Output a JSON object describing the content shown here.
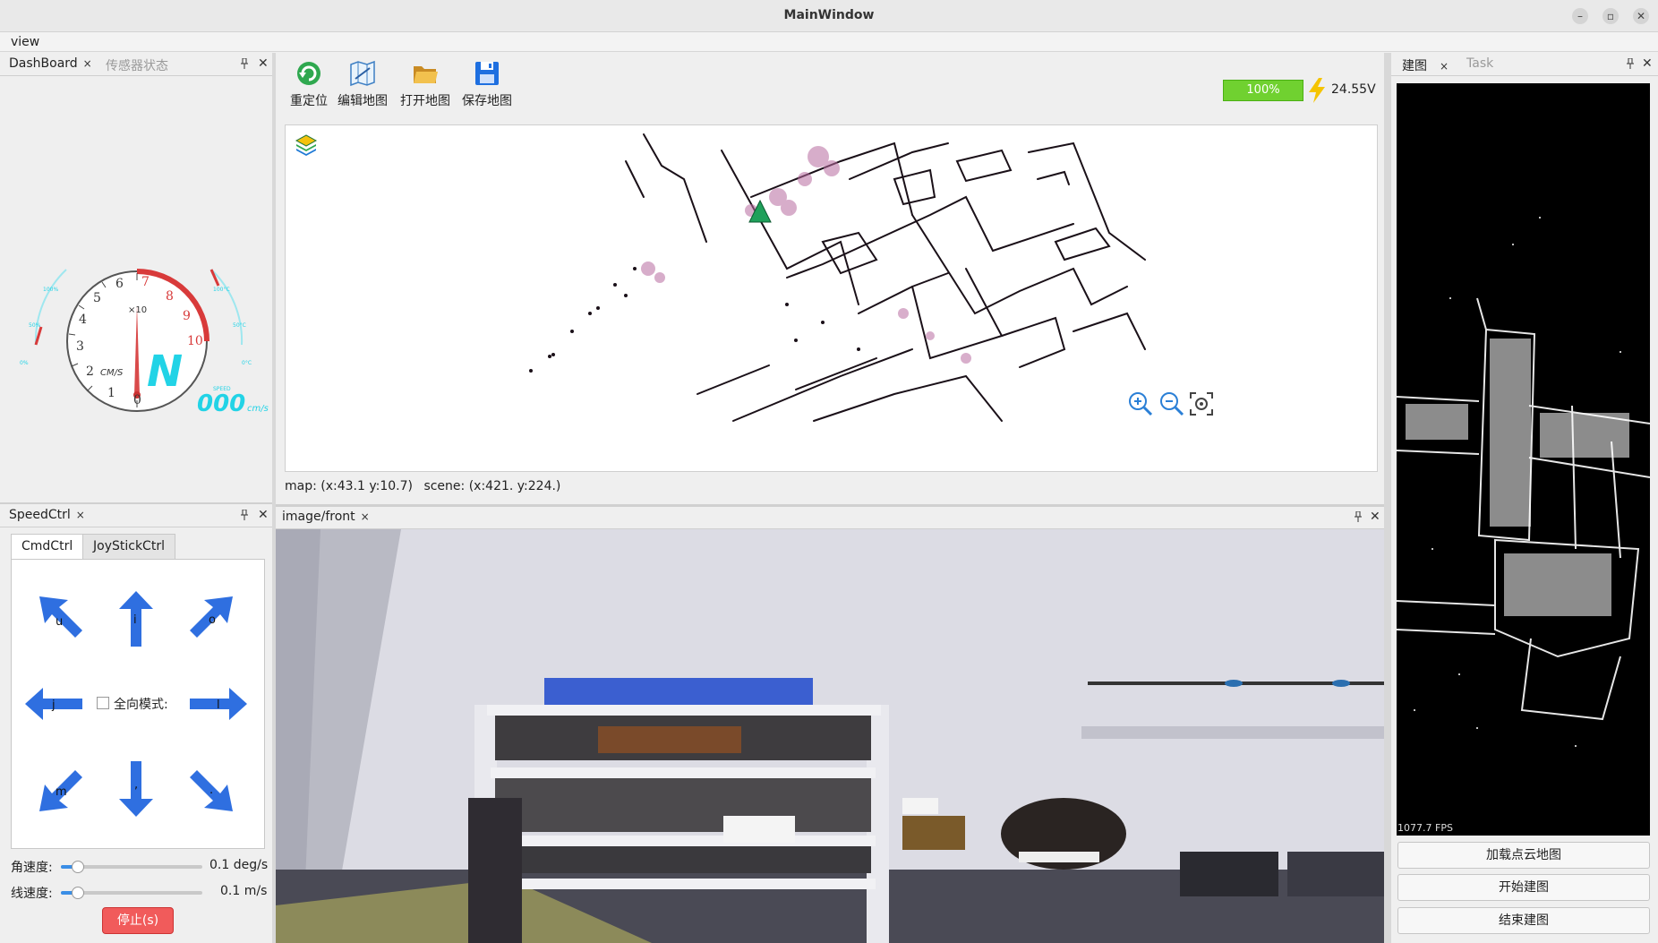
{
  "window": {
    "title": "MainWindow",
    "minimize": "–",
    "maximize": "▫",
    "close": "✕"
  },
  "menubar": {
    "view": "view"
  },
  "dashboard_dock": {
    "tabs": [
      {
        "label": "DashBoard",
        "active": true
      },
      {
        "label": "传感器状态",
        "active": false
      }
    ],
    "close_glyph": "×",
    "gauge": {
      "unit": "CM/S",
      "multiplier": "×10",
      "ticks": [
        "0",
        "1",
        "2",
        "3",
        "4",
        "5",
        "6",
        "7",
        "8",
        "9",
        "10"
      ],
      "gear": "N",
      "speed_caption": "SPEED",
      "speed_value": "000",
      "speed_unit": "cm/s",
      "left_arc_labels": [
        "100%",
        "50%",
        "0%"
      ],
      "right_arc_labels": [
        "100°C",
        "50°C",
        "0°C"
      ]
    }
  },
  "speedctrl_dock": {
    "tab_label": "SpeedCtrl",
    "subtabs": [
      {
        "label": "CmdCtrl",
        "active": true
      },
      {
        "label": "JoyStickCtrl",
        "active": false
      }
    ],
    "keys": {
      "up_left": "u",
      "up": "i",
      "up_right": "o",
      "left": "j",
      "right": "l",
      "down_left": "m",
      "down": ",",
      "down_right": "."
    },
    "omni_mode_label": "全向模式:",
    "omni_mode_checked": false,
    "angular": {
      "label": "角速度:",
      "value": "0.1 deg/s",
      "level": 0.1
    },
    "linear": {
      "label": "线速度:",
      "value": "0.1 m/s",
      "level": 0.1
    },
    "stop_button": "停止(s)"
  },
  "toolbar": {
    "relocate": "重定位",
    "edit_map": "编辑地图",
    "open_map": "打开地图",
    "save_map": "保存地图",
    "battery_percent": "100%",
    "voltage": "24.55V"
  },
  "map_status": {
    "map": "map:  (x:43.1 y:10.7)",
    "scene": "scene:  (x:421. y:224.)"
  },
  "image_dock": {
    "tab_label": "image/front"
  },
  "right_dock": {
    "tabs": [
      {
        "label": "建图",
        "active": true
      },
      {
        "label": "Task",
        "active": false
      }
    ],
    "fps": "1077.7 FPS",
    "buttons": {
      "load_pointcloud_map": "加载点云地图",
      "start_mapping": "开始建图",
      "end_mapping": "结束建图"
    }
  },
  "colors": {
    "accent_blue": "#2f6fe0",
    "battery_green": "#70d130",
    "stop_red": "#f15b5b",
    "gauge_red": "#d83a3a",
    "gauge_cyan": "#22d3e6"
  }
}
